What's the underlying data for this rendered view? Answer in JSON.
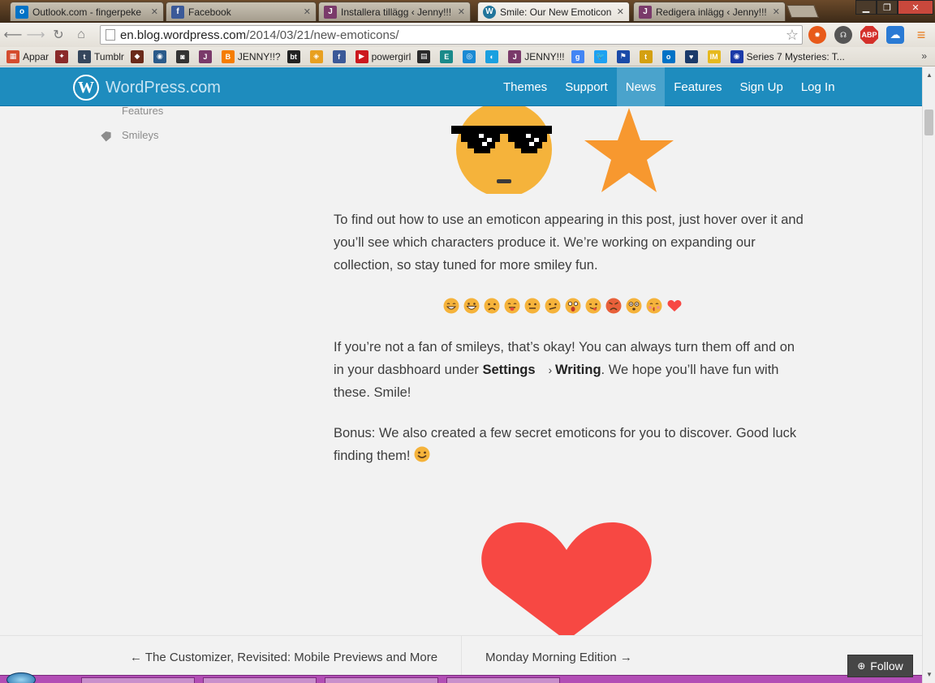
{
  "browser": {
    "tabs": [
      {
        "title": "Outlook.com - fingerpeke",
        "icon": "outlook-icon",
        "color": "#0072c6",
        "glyph": "o"
      },
      {
        "title": "Facebook",
        "icon": "facebook-icon",
        "color": "#3b5998",
        "glyph": "f"
      },
      {
        "title": "Installera tillägg ‹ Jenny!!!",
        "icon": "jenny-blog-icon",
        "color": "#7a3a6a",
        "glyph": "J"
      },
      {
        "title": "Smile: Our New Emoticon",
        "icon": "wordpress-icon",
        "color": "#21759b",
        "glyph": "W"
      },
      {
        "title": "Redigera inlägg ‹ Jenny!!! -",
        "icon": "jenny-blog-icon",
        "color": "#7a3a6a",
        "glyph": "J"
      }
    ],
    "url_host": "en.blog.wordpress.com",
    "url_path": "/2014/03/21/new-emoticons/",
    "bookmarks": [
      {
        "label": "Appar",
        "icon": "apps-grid-icon",
        "color": "#d44c2e",
        "glyph": "▦"
      },
      {
        "label": "",
        "icon": "bookmark-art-icon",
        "color": "#8a2a2a",
        "glyph": "✦"
      },
      {
        "label": "Tumblr",
        "icon": "tumblr-icon",
        "color": "#35465c",
        "glyph": "t"
      },
      {
        "label": "",
        "icon": "bookmark-game-icon",
        "color": "#6a2a1a",
        "glyph": "◆"
      },
      {
        "label": "",
        "icon": "bookmark-chat-icon",
        "color": "#2a5a8a",
        "glyph": "◉"
      },
      {
        "label": "",
        "icon": "bookmark-cat-icon",
        "color": "#333333",
        "glyph": "◙"
      },
      {
        "label": "",
        "icon": "jenny-blog-icon",
        "color": "#7a3a6a",
        "glyph": "J"
      },
      {
        "label": "JENNY!!?",
        "icon": "blogger-icon",
        "color": "#f57d00",
        "glyph": "B"
      },
      {
        "label": "",
        "icon": "bt-icon",
        "color": "#222222",
        "glyph": "bt"
      },
      {
        "label": "",
        "icon": "bookmark-orange-icon",
        "color": "#e8a020",
        "glyph": "◈"
      },
      {
        "label": "",
        "icon": "facebook-icon",
        "color": "#3b5998",
        "glyph": "f"
      },
      {
        "label": "powergirl",
        "icon": "youtube-icon",
        "color": "#cc181e",
        "glyph": "▶"
      },
      {
        "label": "",
        "icon": "bookmark-flag-icon",
        "color": "#2a2a2a",
        "glyph": "▤"
      },
      {
        "label": "",
        "icon": "bookmark-e-icon",
        "color": "#1a8a8a",
        "glyph": "E"
      },
      {
        "label": "",
        "icon": "bookmark-blue-icon",
        "color": "#1a8ad4",
        "glyph": "◎"
      },
      {
        "label": "",
        "icon": "bookmark-telenor-icon",
        "color": "#1aa0e0",
        "glyph": "◐"
      },
      {
        "label": "JENNY!!!",
        "icon": "jenny-blog-icon",
        "color": "#7a3a6a",
        "glyph": "J"
      },
      {
        "label": "",
        "icon": "google-icon",
        "color": "#4285f4",
        "glyph": "g"
      },
      {
        "label": "",
        "icon": "twitter-icon",
        "color": "#1da1f2",
        "glyph": "🐦"
      },
      {
        "label": "",
        "icon": "bookmark-runner-icon",
        "color": "#1a4aa8",
        "glyph": "⚑"
      },
      {
        "label": "",
        "icon": "bookmark-yellow-icon",
        "color": "#d4a010",
        "glyph": "t"
      },
      {
        "label": "",
        "icon": "outlook-icon",
        "color": "#0072c6",
        "glyph": "o"
      },
      {
        "label": "",
        "icon": "bookmark-heart-icon",
        "color": "#1a3a6a",
        "glyph": "♥"
      },
      {
        "label": "",
        "icon": "imdb-icon",
        "color": "#e6b91e",
        "glyph": "IM"
      },
      {
        "label": "Series 7 Mysteries: T...",
        "icon": "bookmark-series-icon",
        "color": "#1a3aa8",
        "glyph": "◉"
      }
    ],
    "extensions": [
      {
        "icon": "fire-extension-icon",
        "color": "#e85a1a",
        "glyph": "✹"
      },
      {
        "icon": "headphones-extension-icon",
        "color": "#555555",
        "glyph": "☊"
      },
      {
        "icon": "adblock-plus-icon",
        "color": "#d4302a",
        "glyph": "ABP"
      },
      {
        "icon": "cloud-extension-icon",
        "color": "#2a7ad4",
        "glyph": "☁"
      },
      {
        "icon": "menu-icon",
        "color": "#e87a1a",
        "glyph": "≡"
      }
    ]
  },
  "site": {
    "logo_text": "WordPress.com",
    "nav": [
      "Themes",
      "Support",
      "News",
      "Features",
      "Sign Up",
      "Log In"
    ],
    "current_nav": "News"
  },
  "sidebar": {
    "tags": [
      "Features",
      "Smileys"
    ]
  },
  "post": {
    "paragraph1": "To find out how to use an emoticon appearing in this post, just hover over it and you’ll see which characters produce it. We’re working on expanding our collection, so stay tuned for more smiley fun.",
    "paragraph2_a": "If you’re not a fan of smileys, that’s okay! You can always turn them off and on in your dasbhoard under ",
    "paragraph2_settings": "Settings",
    "paragraph2_arrow": " › ",
    "paragraph2_writing": "Writing",
    "paragraph2_b": ". We hope you’ll have fun with these. Smile!",
    "paragraph3": "Bonus: We also created a few secret emoticons for you to discover. Good luck finding them!",
    "emoticons": [
      "grin",
      "big-grin",
      "frown",
      "tongue",
      "neutral",
      "confused",
      "shocked",
      "wink-tongue",
      "mad",
      "eek",
      "kiss",
      "heart"
    ]
  },
  "post_nav": {
    "prev": "← The Customizer, Revisited: Mobile Previews and More",
    "next": "Monday Morning Edition →"
  },
  "follow_label": "Follow",
  "colors": {
    "brand_blue": "#1e8cbe",
    "emoji_yellow": "#f5b33b",
    "star_orange": "#f7982f",
    "heart_red": "#f74843"
  }
}
